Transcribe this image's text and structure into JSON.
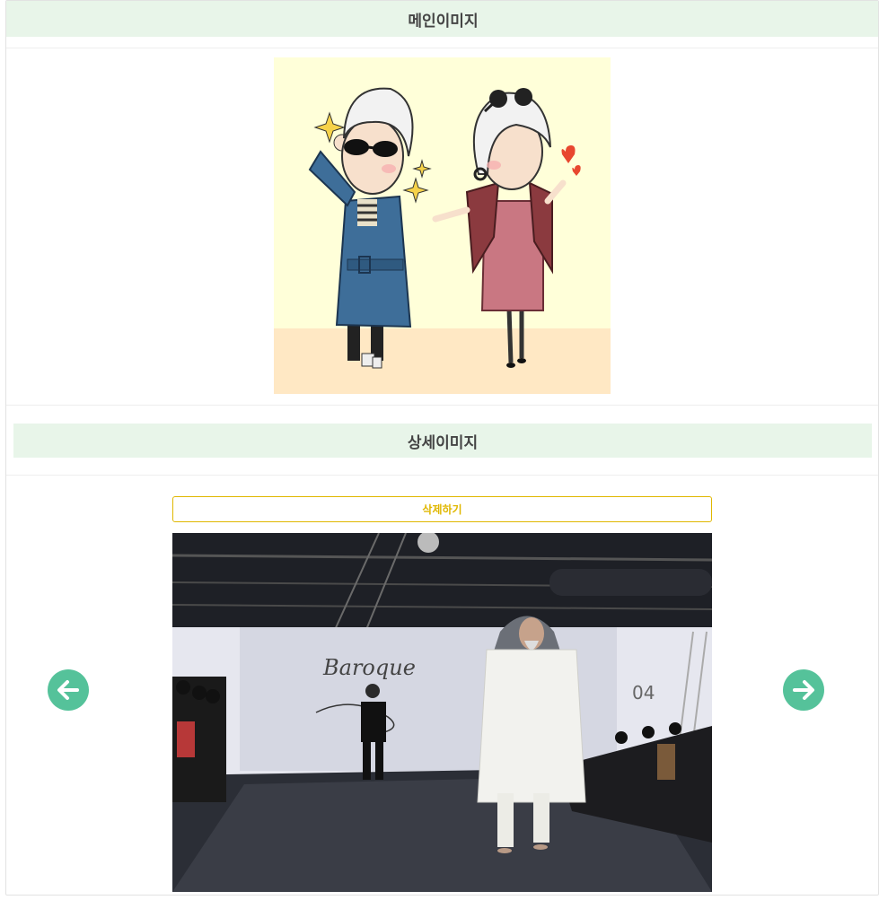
{
  "main_section": {
    "title": "메인이미지",
    "image_icon": "elderly-couple-illustration"
  },
  "detail_section": {
    "title": "상세이미지",
    "delete_label": "삭제하기",
    "slide_text": "Baroque",
    "slide_number": "04",
    "prev_icon": "arrow-left-icon",
    "next_icon": "arrow-right-icon"
  },
  "colors": {
    "header_bg": "#e8f5e9",
    "accent": "#55c29a",
    "delete": "#e0b700"
  }
}
